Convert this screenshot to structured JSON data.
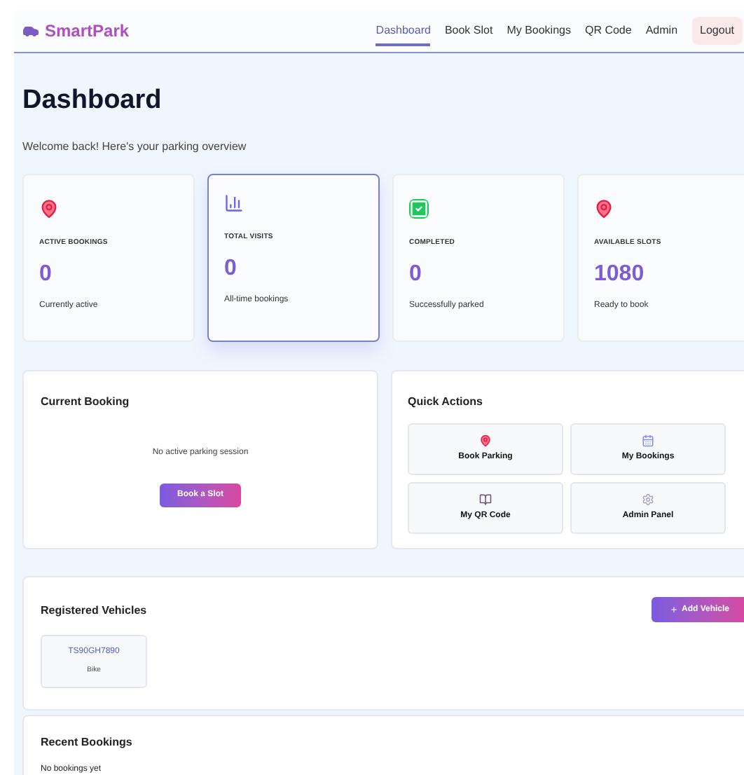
{
  "brand": "SmartPark",
  "nav": [
    {
      "label": "Dashboard",
      "selected": true
    },
    {
      "label": "Book Slot",
      "selected": false
    },
    {
      "label": "My Bookings",
      "selected": false
    },
    {
      "label": "QR Code",
      "selected": false
    },
    {
      "label": "Admin",
      "selected": false
    }
  ],
  "logout": "Logout",
  "title": "Dashboard",
  "subtitle": "Welcome back! Here's your parking overview",
  "stats": [
    {
      "kind": "pin",
      "label": "ACTIVE BOOKINGS",
      "value": "0",
      "note": "Currently active",
      "selected": false
    },
    {
      "kind": "chart",
      "label": "TOTAL VISITS",
      "value": "0",
      "note": "All-time bookings",
      "selected": true
    },
    {
      "kind": "check",
      "label": "COMPLETED",
      "value": "0",
      "note": "Successfully parked",
      "selected": false
    },
    {
      "kind": "pin",
      "label": "AVAILABLE SLOTS",
      "value": "1080",
      "note": "Ready to book",
      "selected": false
    }
  ],
  "current_booking": {
    "title": "Current Booking",
    "message": "No active parking session",
    "button": "Book a Slot"
  },
  "quick_actions": {
    "title": "Quick Actions",
    "items": [
      {
        "kind": "pin",
        "label": "Book Parking"
      },
      {
        "kind": "calendar",
        "label": "My Bookings"
      },
      {
        "kind": "book",
        "label": "My QR Code"
      },
      {
        "kind": "gear",
        "label": "Admin Panel"
      }
    ]
  },
  "vehicles": {
    "title": "Registered Vehicles",
    "button": "Add Vehicle",
    "items": [
      {
        "plate": "TS90GH7890",
        "type": "Bike"
      }
    ]
  },
  "recent_bookings": {
    "title": "Recent Bookings",
    "message": "No bookings yet"
  }
}
